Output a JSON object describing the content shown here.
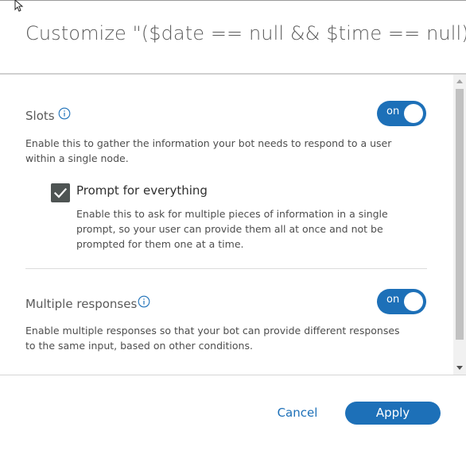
{
  "dialog": {
    "title": "Customize \"($date == null && $time == null)\""
  },
  "slots": {
    "label": "Slots",
    "toggle_text": "on",
    "toggle_state": true,
    "description_line1": "Enable this to gather the information your bot needs to respond to a user",
    "description_line2": "within a single node.",
    "prompt_checkbox": {
      "label": "Prompt for everything",
      "checked": true,
      "description_line1": "Enable this to ask for multiple pieces of information in a single",
      "description_line2": "prompt, so your user can provide them all at once and not be",
      "description_line3": "prompted for them one at a time."
    }
  },
  "multiple_responses": {
    "label": "Multiple responses",
    "toggle_text": "on",
    "toggle_state": true,
    "description_line1": "Enable multiple responses so that your bot can provide different responses",
    "description_line2": "to the same input, based on other conditions."
  },
  "footer": {
    "cancel_label": "Cancel",
    "apply_label": "Apply"
  },
  "colors": {
    "accent": "#1d70b8",
    "checkbox": "#4e5453"
  },
  "icons": {
    "info": "info-icon",
    "check": "checkmark-icon",
    "cursor": "mouse-pointer-icon"
  }
}
